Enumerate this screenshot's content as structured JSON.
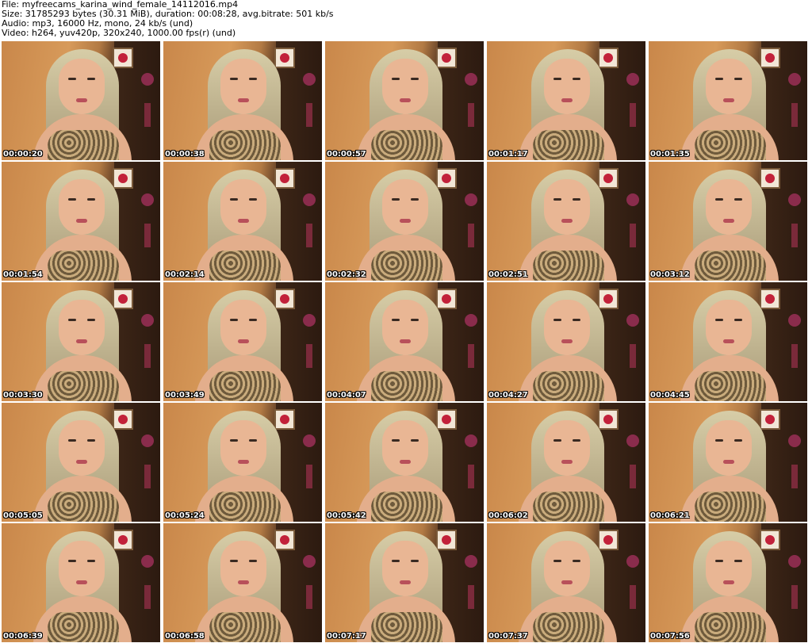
{
  "header": {
    "file": "File: myfreecams_karina_wind_female_14112016.mp4",
    "size": "Size: 31785293 bytes (30.31 MiB), duration: 00:08:28, avg.bitrate: 501 kb/s",
    "audio": "Audio: mp3, 16000 Hz, mono, 24 kb/s (und)",
    "video": "Video: h264, yuv420p, 320x240, 1000.00 fps(r) (und)"
  },
  "thumbnails": [
    {
      "timestamp": "00:00:20"
    },
    {
      "timestamp": "00:00:38"
    },
    {
      "timestamp": "00:00:57"
    },
    {
      "timestamp": "00:01:17"
    },
    {
      "timestamp": "00:01:35"
    },
    {
      "timestamp": "00:01:54"
    },
    {
      "timestamp": "00:02:14"
    },
    {
      "timestamp": "00:02:32"
    },
    {
      "timestamp": "00:02:51"
    },
    {
      "timestamp": "00:03:12"
    },
    {
      "timestamp": "00:03:30"
    },
    {
      "timestamp": "00:03:49"
    },
    {
      "timestamp": "00:04:07"
    },
    {
      "timestamp": "00:04:27"
    },
    {
      "timestamp": "00:04:45"
    },
    {
      "timestamp": "00:05:05"
    },
    {
      "timestamp": "00:05:24"
    },
    {
      "timestamp": "00:05:42"
    },
    {
      "timestamp": "00:06:02"
    },
    {
      "timestamp": "00:06:21"
    },
    {
      "timestamp": "00:06:39"
    },
    {
      "timestamp": "00:06:58"
    },
    {
      "timestamp": "00:07:17"
    },
    {
      "timestamp": "00:07:37"
    },
    {
      "timestamp": "00:07:56"
    }
  ]
}
